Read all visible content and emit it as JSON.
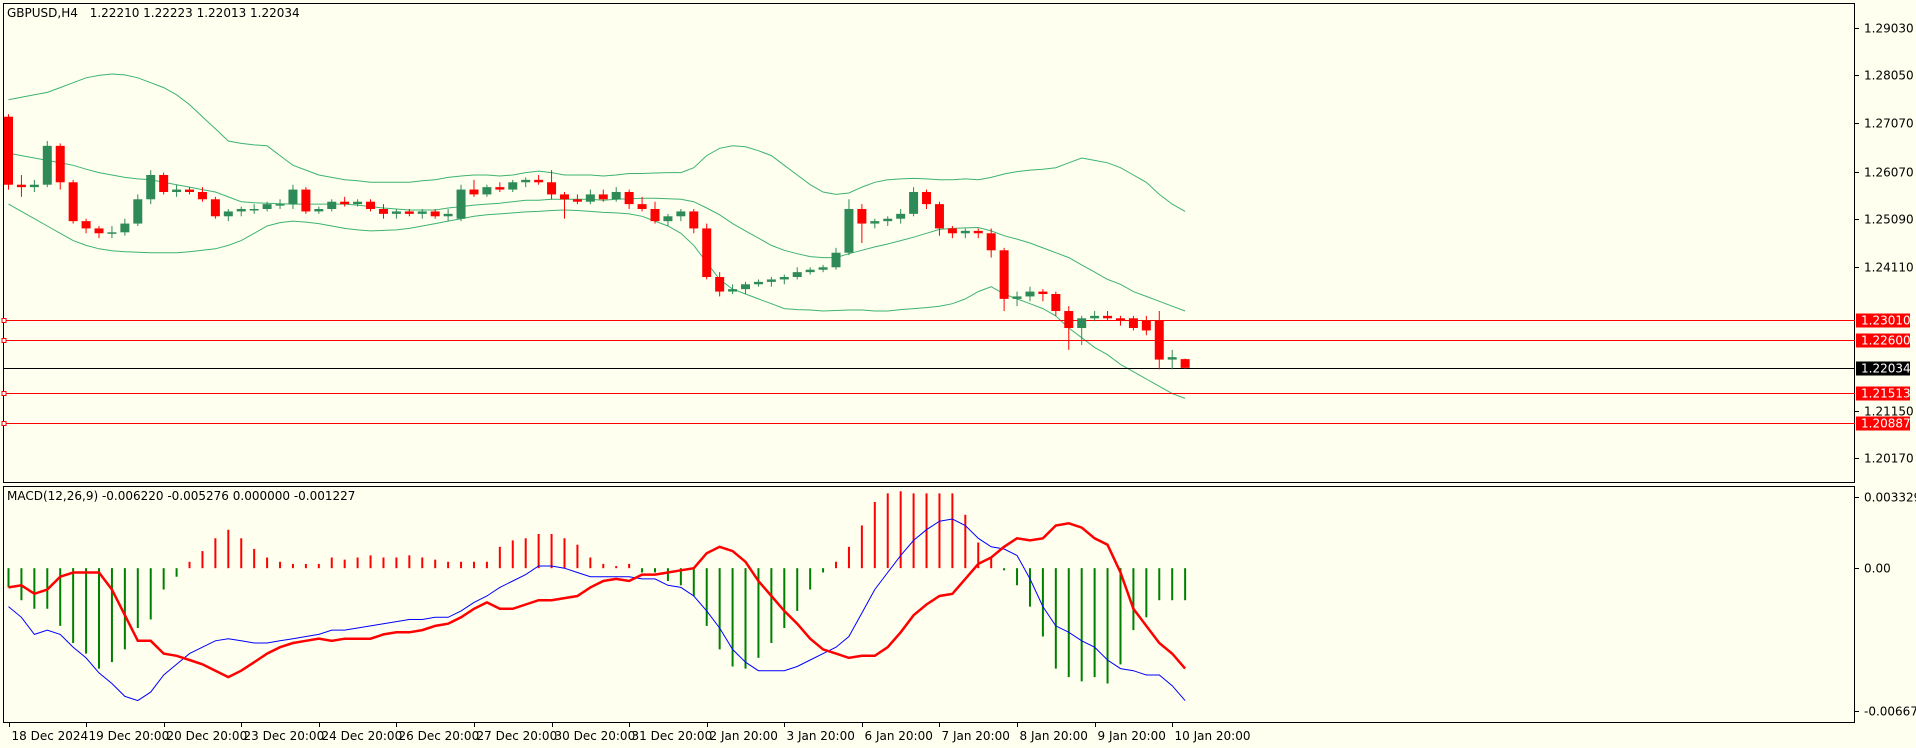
{
  "header": {
    "symbol": "GBPUSD,H4",
    "ohlc": "1.22210 1.22223 1.22013 1.22034"
  },
  "macd_header": "MACD(12,26,9) -0.006220 -0.005276 0.000000 -0.001227",
  "colors": {
    "background": "#FFFFF0",
    "bull": "#2E8B57",
    "bear": "#FF0000",
    "bands": "#3CB371",
    "level_line": "#FF0000",
    "current_line": "#000000",
    "macd_main": "#0000FF",
    "macd_signal": "#FF0000",
    "hist_pos": "#FF0000",
    "hist_neg": "#008000"
  },
  "chart_data": [
    {
      "type": "candlestick",
      "ylim": [
        1.1968,
        1.2952
      ],
      "y_ticks": [
        "1.29030",
        "1.28050",
        "1.27070",
        "1.26070",
        "1.25090",
        "1.24110",
        "1.21150",
        "1.20170"
      ],
      "x_ticks": [
        "18 Dec 2024",
        "19 Dec 20:00",
        "20 Dec 20:00",
        "23 Dec 20:00",
        "24 Dec 20:00",
        "26 Dec 20:00",
        "27 Dec 20:00",
        "30 Dec 20:00",
        "31 Dec 20:00",
        "2 Jan 20:00",
        "3 Jan 20:00",
        "6 Jan 20:00",
        "7 Jan 20:00",
        "8 Jan 20:00",
        "9 Jan 20:00",
        "10 Jan 20:00"
      ],
      "levels": [
        "1.23010",
        "1.22600",
        "1.21513",
        "1.20887"
      ],
      "current_price": "1.22034",
      "candles": [
        [
          1.272,
          1.2725,
          1.257,
          1.258
        ],
        [
          1.258,
          1.26,
          1.2555,
          1.2575
        ],
        [
          1.2575,
          1.259,
          1.2565,
          1.258
        ],
        [
          1.258,
          1.267,
          1.2575,
          1.266
        ],
        [
          1.266,
          1.2665,
          1.257,
          1.2585
        ],
        [
          1.2585,
          1.259,
          1.25,
          1.2505
        ],
        [
          1.2505,
          1.251,
          1.248,
          1.249
        ],
        [
          1.249,
          1.2495,
          1.247,
          1.248
        ],
        [
          1.248,
          1.2495,
          1.247,
          1.2482
        ],
        [
          1.2482,
          1.251,
          1.2475,
          1.25
        ],
        [
          1.25,
          1.256,
          1.2495,
          1.255
        ],
        [
          1.255,
          1.261,
          1.254,
          1.26
        ],
        [
          1.26,
          1.2605,
          1.256,
          1.2565
        ],
        [
          1.2565,
          1.258,
          1.2555,
          1.257
        ],
        [
          1.257,
          1.2575,
          1.256,
          1.2565
        ],
        [
          1.2565,
          1.2575,
          1.2545,
          1.255
        ],
        [
          1.255,
          1.2555,
          1.251,
          1.2515
        ],
        [
          1.2515,
          1.253,
          1.2505,
          1.2525
        ],
        [
          1.2525,
          1.2535,
          1.2515,
          1.253
        ],
        [
          1.253,
          1.254,
          1.252,
          1.253
        ],
        [
          1.253,
          1.2545,
          1.2525,
          1.254
        ],
        [
          1.254,
          1.255,
          1.253,
          1.254
        ],
        [
          1.254,
          1.258,
          1.253,
          1.257
        ],
        [
          1.257,
          1.2575,
          1.252,
          1.2525
        ],
        [
          1.2525,
          1.2535,
          1.252,
          1.253
        ],
        [
          1.253,
          1.255,
          1.2525,
          1.2545
        ],
        [
          1.2545,
          1.2555,
          1.2535,
          1.254
        ],
        [
          1.254,
          1.255,
          1.2535,
          1.2545
        ],
        [
          1.2545,
          1.255,
          1.2525,
          1.253
        ],
        [
          1.253,
          1.254,
          1.251,
          1.252
        ],
        [
          1.252,
          1.253,
          1.251,
          1.2525
        ],
        [
          1.2525,
          1.253,
          1.2515,
          1.252
        ],
        [
          1.252,
          1.253,
          1.251,
          1.2525
        ],
        [
          1.2525,
          1.253,
          1.251,
          1.2515
        ],
        [
          1.2515,
          1.253,
          1.2505,
          1.252
        ],
        [
          1.251,
          1.258,
          1.2505,
          1.257
        ],
        [
          1.257,
          1.259,
          1.2555,
          1.256
        ],
        [
          1.256,
          1.258,
          1.2555,
          1.2575
        ],
        [
          1.2575,
          1.2585,
          1.2565,
          1.257
        ],
        [
          1.257,
          1.259,
          1.2565,
          1.2585
        ],
        [
          1.2585,
          1.2595,
          1.2575,
          1.259
        ],
        [
          1.259,
          1.26,
          1.258,
          1.2585
        ],
        [
          1.2585,
          1.261,
          1.255,
          1.256
        ],
        [
          1.256,
          1.2565,
          1.251,
          1.255
        ],
        [
          1.255,
          1.256,
          1.254,
          1.2545
        ],
        [
          1.2545,
          1.257,
          1.254,
          1.256
        ],
        [
          1.256,
          1.257,
          1.2545,
          1.255
        ],
        [
          1.255,
          1.2575,
          1.2545,
          1.2565
        ],
        [
          1.2565,
          1.257,
          1.253,
          1.254
        ],
        [
          1.254,
          1.2555,
          1.2525,
          1.253
        ],
        [
          1.253,
          1.2545,
          1.25,
          1.2505
        ],
        [
          1.2505,
          1.252,
          1.2495,
          1.2515
        ],
        [
          1.2515,
          1.253,
          1.2505,
          1.2525
        ],
        [
          1.2525,
          1.253,
          1.248,
          1.249
        ],
        [
          1.249,
          1.25,
          1.2385,
          1.239
        ],
        [
          1.239,
          1.24,
          1.235,
          1.236
        ],
        [
          1.236,
          1.2375,
          1.2355,
          1.2365
        ],
        [
          1.2365,
          1.238,
          1.2355,
          1.2375
        ],
        [
          1.2375,
          1.2385,
          1.237,
          1.238
        ],
        [
          1.238,
          1.239,
          1.237,
          1.2385
        ],
        [
          1.2385,
          1.2395,
          1.2375,
          1.239
        ],
        [
          1.239,
          1.241,
          1.2385,
          1.24
        ],
        [
          1.24,
          1.241,
          1.2395,
          1.2405
        ],
        [
          1.2405,
          1.2415,
          1.24,
          1.241
        ],
        [
          1.241,
          1.245,
          1.2405,
          1.244
        ],
        [
          1.244,
          1.255,
          1.2435,
          1.253
        ],
        [
          1.253,
          1.254,
          1.246,
          1.25
        ],
        [
          1.25,
          1.251,
          1.249,
          1.2505
        ],
        [
          1.2505,
          1.2515,
          1.2495,
          1.251
        ],
        [
          1.251,
          1.253,
          1.25,
          1.252
        ],
        [
          1.252,
          1.2575,
          1.2515,
          1.2565
        ],
        [
          1.2565,
          1.257,
          1.253,
          1.254
        ],
        [
          1.254,
          1.2545,
          1.2475,
          1.249
        ],
        [
          1.249,
          1.2495,
          1.247,
          1.248
        ],
        [
          1.248,
          1.249,
          1.247,
          1.2485
        ],
        [
          1.2485,
          1.249,
          1.247,
          1.248
        ],
        [
          1.248,
          1.249,
          1.243,
          1.2445
        ],
        [
          1.2445,
          1.245,
          1.232,
          1.2345
        ],
        [
          1.2345,
          1.236,
          1.233,
          1.235
        ],
        [
          1.235,
          1.237,
          1.234,
          1.236
        ],
        [
          1.236,
          1.2365,
          1.234,
          1.2355
        ],
        [
          1.2355,
          1.236,
          1.231,
          1.232
        ],
        [
          1.232,
          1.233,
          1.224,
          1.2285
        ],
        [
          1.2285,
          1.231,
          1.225,
          1.2305
        ],
        [
          1.2305,
          1.232,
          1.23,
          1.231
        ],
        [
          1.231,
          1.232,
          1.23,
          1.2305
        ],
        [
          1.2305,
          1.231,
          1.229,
          1.23
        ],
        [
          1.2305,
          1.231,
          1.228,
          1.2285
        ],
        [
          1.23,
          1.231,
          1.227,
          1.228
        ],
        [
          1.23,
          1.232,
          1.22,
          1.222
        ],
        [
          1.222,
          1.224,
          1.22,
          1.2225
        ],
        [
          1.2221,
          1.2222,
          1.2201,
          1.2203
        ]
      ],
      "bb_upper": [
        1.2755,
        1.276,
        1.2765,
        1.277,
        1.278,
        1.279,
        1.28,
        1.2805,
        1.2808,
        1.2806,
        1.28,
        1.279,
        1.278,
        1.2765,
        1.2745,
        1.272,
        1.2695,
        1.267,
        1.2665,
        1.2662,
        1.266,
        1.264,
        1.262,
        1.261,
        1.26,
        1.2595,
        1.259,
        1.2588,
        1.2585,
        1.2585,
        1.2585,
        1.2585,
        1.2588,
        1.259,
        1.2595,
        1.2598,
        1.26,
        1.26,
        1.2598,
        1.26,
        1.2605,
        1.2608,
        1.2605,
        1.26,
        1.26,
        1.26,
        1.2598,
        1.26,
        1.2603,
        1.2603,
        1.2604,
        1.2605,
        1.2605,
        1.2615,
        1.264,
        1.2655,
        1.266,
        1.2658,
        1.265,
        1.264,
        1.262,
        1.26,
        1.258,
        1.2565,
        1.256,
        1.2563,
        1.2575,
        1.2585,
        1.259,
        1.2592,
        1.2593,
        1.2592,
        1.259,
        1.259,
        1.2592,
        1.259,
        1.2595,
        1.2602,
        1.2607,
        1.261,
        1.2612,
        1.2615,
        1.2625,
        1.2635,
        1.263,
        1.2625,
        1.2615,
        1.26,
        1.2585,
        1.256,
        1.254,
        1.2525
      ],
      "bb_middle": [
        1.2645,
        1.264,
        1.2635,
        1.263,
        1.2625,
        1.262,
        1.2612,
        1.2605,
        1.26,
        1.2595,
        1.2592,
        1.259,
        1.2585,
        1.258,
        1.2575,
        1.257,
        1.2565,
        1.2555,
        1.2545,
        1.2543,
        1.2542,
        1.2541,
        1.254,
        1.254,
        1.254,
        1.254,
        1.254,
        1.2538,
        1.2535,
        1.2532,
        1.253,
        1.2528,
        1.2528,
        1.2528,
        1.2532,
        1.2535,
        1.2538,
        1.254,
        1.2542,
        1.2545,
        1.2548,
        1.2548,
        1.255,
        1.255,
        1.255,
        1.255,
        1.2548,
        1.255,
        1.2551,
        1.2552,
        1.2552,
        1.2551,
        1.255,
        1.2545,
        1.2532,
        1.2518,
        1.25,
        1.2485,
        1.247,
        1.2455,
        1.2445,
        1.2438,
        1.2432,
        1.243,
        1.243,
        1.2438,
        1.2445,
        1.2452,
        1.2458,
        1.2465,
        1.2472,
        1.248,
        1.2488,
        1.249,
        1.2491,
        1.2492,
        1.2485,
        1.2475,
        1.2468,
        1.246,
        1.245,
        1.244,
        1.243,
        1.2415,
        1.24,
        1.2385,
        1.2375,
        1.236,
        1.235,
        1.234,
        1.233,
        1.232
      ],
      "bb_lower": [
        1.254,
        1.2525,
        1.251,
        1.2495,
        1.248,
        1.2465,
        1.2455,
        1.2448,
        1.2444,
        1.2442,
        1.2441,
        1.244,
        1.244,
        1.244,
        1.2442,
        1.2445,
        1.2448,
        1.2455,
        1.2465,
        1.248,
        1.2495,
        1.2502,
        1.2505,
        1.2503,
        1.25,
        1.2495,
        1.249,
        1.2487,
        1.2485,
        1.2486,
        1.2487,
        1.249,
        1.2495,
        1.25,
        1.2505,
        1.251,
        1.2515,
        1.2518,
        1.252,
        1.2522,
        1.2524,
        1.2525,
        1.2527,
        1.2528,
        1.2527,
        1.2525,
        1.2523,
        1.2522,
        1.252,
        1.2515,
        1.2505,
        1.2495,
        1.248,
        1.2455,
        1.242,
        1.2385,
        1.2365,
        1.2355,
        1.2345,
        1.2335,
        1.2325,
        1.2323,
        1.2322,
        1.232,
        1.2321,
        1.2322,
        1.2322,
        1.232,
        1.232,
        1.2323,
        1.2325,
        1.2327,
        1.233,
        1.2335,
        1.2345,
        1.236,
        1.237,
        1.2355,
        1.2345,
        1.2335,
        1.2325,
        1.231,
        1.2285,
        1.2265,
        1.2245,
        1.223,
        1.221,
        1.2195,
        1.218,
        1.2165,
        1.215,
        1.214
      ]
    },
    {
      "type": "bar+line",
      "ylim": [
        -0.0072,
        0.0038
      ],
      "y_ticks": [
        "0.003329",
        "0.00",
        "-0.006675"
      ],
      "histogram": [
        -0.0009,
        -0.0015,
        -0.0019,
        -0.0019,
        -0.0027,
        -0.0035,
        -0.004,
        -0.0047,
        -0.0044,
        -0.0038,
        -0.0028,
        -0.0024,
        -0.001,
        -0.0004,
        0.0003,
        0.0008,
        0.0014,
        0.0018,
        0.0014,
        0.0009,
        0.0005,
        0.0003,
        0.0002,
        0.0002,
        0.0002,
        0.0005,
        0.0004,
        0.0005,
        0.0006,
        0.0005,
        0.0005,
        0.0006,
        0.0005,
        0.0004,
        0.0003,
        0.0003,
        0.0003,
        0.0003,
        0.001,
        0.0013,
        0.0014,
        0.0016,
        0.0016,
        0.0014,
        0.0011,
        0.0005,
        0.0002,
        0.0001,
        0.0002,
        -0.0002,
        -0.0002,
        -0.0006,
        -0.0008,
        -0.0013,
        -0.0027,
        -0.0038,
        -0.0046,
        -0.0047,
        -0.0042,
        -0.0035,
        -0.0028,
        -0.002,
        -0.001,
        -0.0002,
        0.0003,
        0.001,
        0.002,
        0.0031,
        0.0035,
        0.0036,
        0.0035,
        0.0035,
        0.0035,
        0.0035,
        0.0025,
        0.0012,
        0.0005,
        -0.0001,
        -0.0008,
        -0.0018,
        -0.0032,
        -0.0047,
        -0.0051,
        -0.0053,
        -0.0051,
        -0.0054,
        -0.0045,
        -0.0029,
        -0.0023,
        -0.0015,
        -0.0015,
        -0.0015
      ],
      "macd_main": [
        -0.0018,
        -0.0023,
        -0.0031,
        -0.0029,
        -0.0031,
        -0.0037,
        -0.0042,
        -0.0049,
        -0.0054,
        -0.006,
        -0.0062,
        -0.0058,
        -0.005,
        -0.0045,
        -0.004,
        -0.0037,
        -0.0034,
        -0.0033,
        -0.0034,
        -0.0035,
        -0.0035,
        -0.0034,
        -0.0033,
        -0.0032,
        -0.0031,
        -0.0029,
        -0.0029,
        -0.0028,
        -0.0027,
        -0.0026,
        -0.0025,
        -0.0024,
        -0.0024,
        -0.0023,
        -0.0023,
        -0.002,
        -0.0016,
        -0.0013,
        -0.0009,
        -0.0006,
        -0.0003,
        0.0001,
        0.0001,
        0.0,
        -0.0002,
        -0.0004,
        -0.0004,
        -0.0004,
        -0.0004,
        -0.0005,
        -0.0005,
        -0.0008,
        -0.0009,
        -0.0013,
        -0.002,
        -0.0028,
        -0.0038,
        -0.0044,
        -0.0048,
        -0.0048,
        -0.0048,
        -0.0046,
        -0.0043,
        -0.004,
        -0.0037,
        -0.0032,
        -0.0021,
        -0.001,
        -0.0002,
        0.0006,
        0.0013,
        0.0018,
        0.0022,
        0.0023,
        0.002,
        0.0014,
        0.001,
        0.0009,
        0.0006,
        -0.0005,
        -0.0018,
        -0.0027,
        -0.003,
        -0.0034,
        -0.0037,
        -0.0043,
        -0.0047,
        -0.0048,
        -0.005,
        -0.005,
        -0.0055,
        -0.0062
      ]
    }
  ]
}
